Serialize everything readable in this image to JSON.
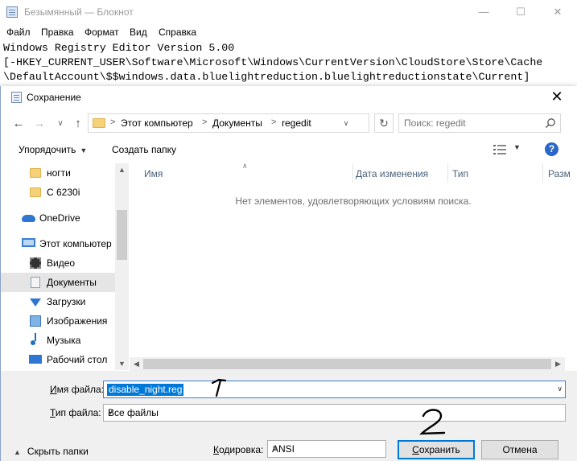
{
  "notepad": {
    "title": "Безымянный — Блокнот",
    "menu": [
      "Файл",
      "Правка",
      "Формат",
      "Вид",
      "Справка"
    ],
    "text_lines": [
      "Windows Registry Editor Version 5.00",
      "[-HKEY_CURRENT_USER\\Software\\Microsoft\\Windows\\CurrentVersion\\CloudStore\\Store\\Cache",
      "\\DefaultAccount\\$$windows.data.bluelightreduction.bluelightreductionstate\\Current]"
    ]
  },
  "dialog": {
    "title": "Сохранение",
    "close": "✕",
    "address": {
      "crumbs": [
        "Этот компьютер",
        "Документы",
        "regedit"
      ]
    },
    "search": {
      "placeholder": "Поиск: regedit"
    },
    "toolbar": {
      "organize": "Упорядочить",
      "new_folder": "Создать папку"
    },
    "nav_pane": [
      {
        "label": "ногти",
        "icon": "folder-icon"
      },
      {
        "label": "C 6230i",
        "icon": "folder-icon"
      },
      {
        "label": "OneDrive",
        "icon": "onedrive-icon"
      },
      {
        "label": "Этот компьютер",
        "icon": "computer-icon"
      },
      {
        "label": "Видео",
        "icon": "video-icon"
      },
      {
        "label": "Документы",
        "icon": "documents-icon",
        "selected": true
      },
      {
        "label": "Загрузки",
        "icon": "downloads-icon"
      },
      {
        "label": "Изображения",
        "icon": "images-icon"
      },
      {
        "label": "Музыка",
        "icon": "music-icon"
      },
      {
        "label": "Рабочий стол",
        "icon": "desktop-icon"
      }
    ],
    "columns": [
      "Имя",
      "Дата изменения",
      "Тип",
      "Разм"
    ],
    "empty_message": "Нет элементов, удовлетворяющих условиям поиска.",
    "filename": {
      "label_prefix": "И",
      "label_rest": "мя файла:",
      "value": "disable_night.reg"
    },
    "filetype": {
      "label_prefix": "Т",
      "label_rest": "ип файла:",
      "value": "Все файлы"
    },
    "hide_folders": "Скрыть папки",
    "encoding": {
      "label_prefix": "К",
      "label_rest": "одировка:",
      "value": "ANSI"
    },
    "save_button": {
      "prefix": "С",
      "rest": "охранить"
    },
    "cancel_button": "Отмена"
  },
  "annotations": [
    "1",
    "2"
  ],
  "colors": {
    "accent": "#0078d7",
    "help": "#2a66c7",
    "folder": "#f5d27a"
  }
}
